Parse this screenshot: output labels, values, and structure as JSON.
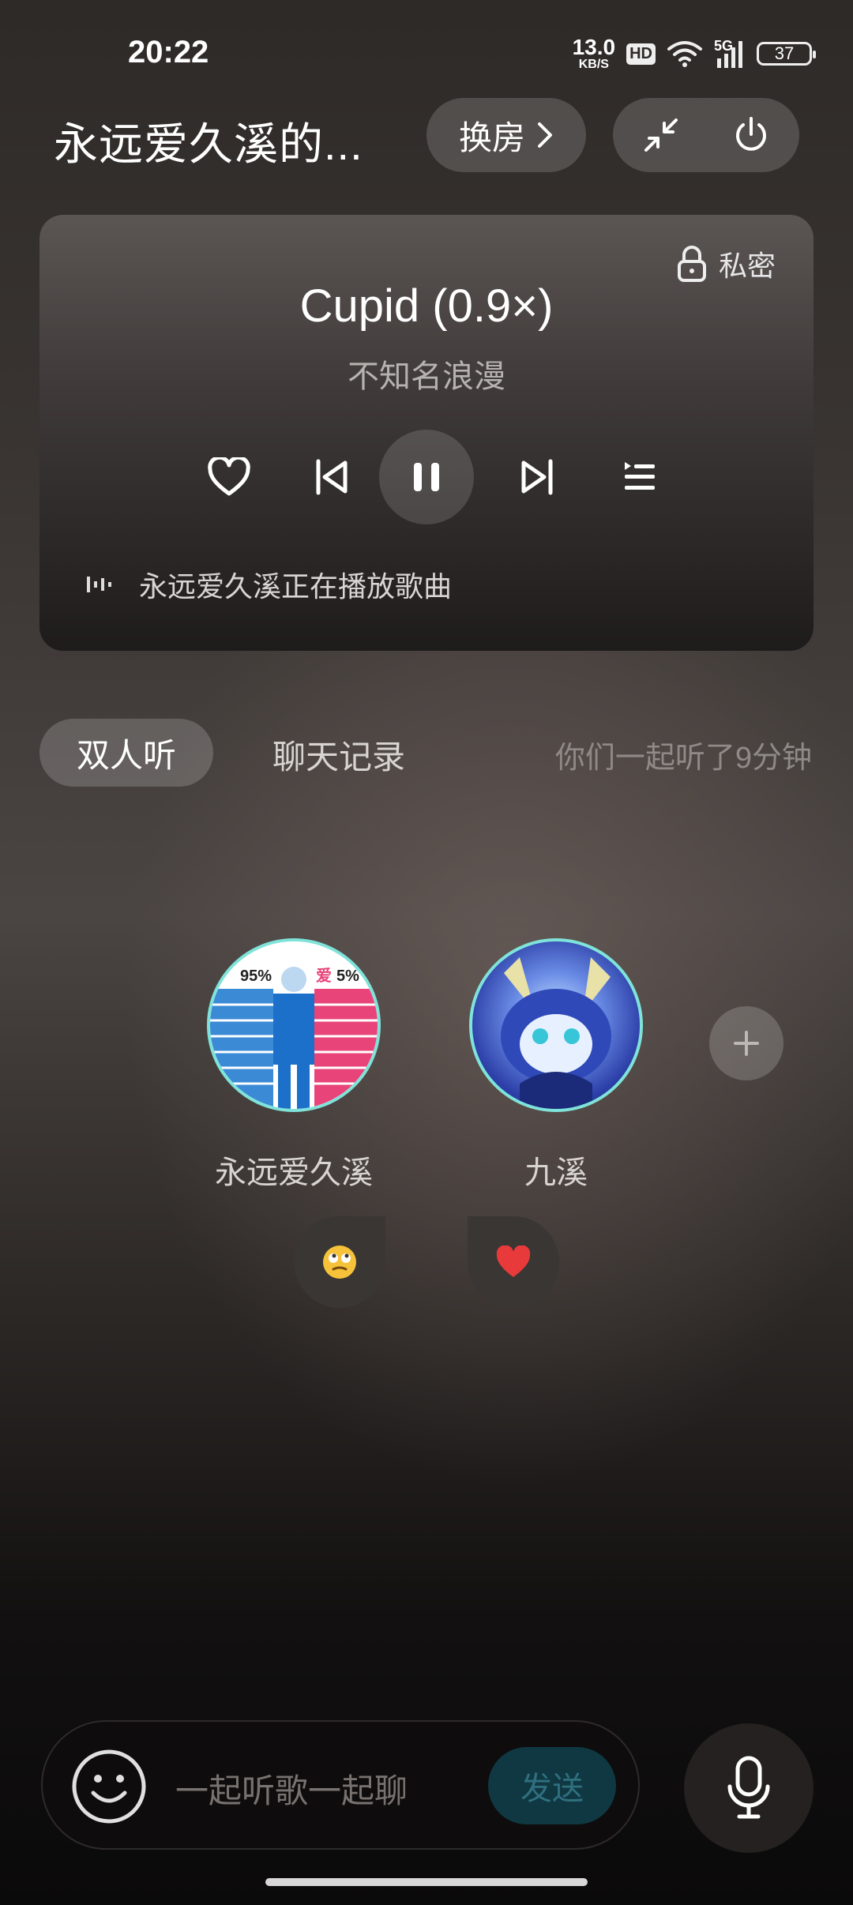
{
  "status_bar": {
    "time": "20:22",
    "net_speed_value": "13.0",
    "net_speed_unit": "KB/S",
    "hd_badge": "HD",
    "network_type": "5G",
    "battery": "37"
  },
  "header": {
    "room_title": "永远爱久溪的...",
    "switch_room_label": "换房"
  },
  "player": {
    "private_label": "私密",
    "song_title": "Cupid (0.9×)",
    "artist": "不知名浪漫",
    "now_playing_text": "永远爱久溪正在播放歌曲"
  },
  "tabs": {
    "duo_listen": "双人听",
    "chat_history": "聊天记录",
    "listen_duration": "你们一起听了9分钟"
  },
  "users": [
    {
      "name": "永远爱久溪",
      "reaction": "eyeroll-emoji"
    },
    {
      "name": "九溪",
      "reaction": "red-heart-emoji"
    }
  ],
  "avatar1_art": {
    "left_pct": "95%",
    "right_pct": "5%",
    "right_char": "爱"
  },
  "input": {
    "placeholder": "一起听歌一起聊",
    "send_label": "发送"
  },
  "colors": {
    "avatar_ring": "#7fe3d9",
    "send_button": "#0f3842"
  }
}
